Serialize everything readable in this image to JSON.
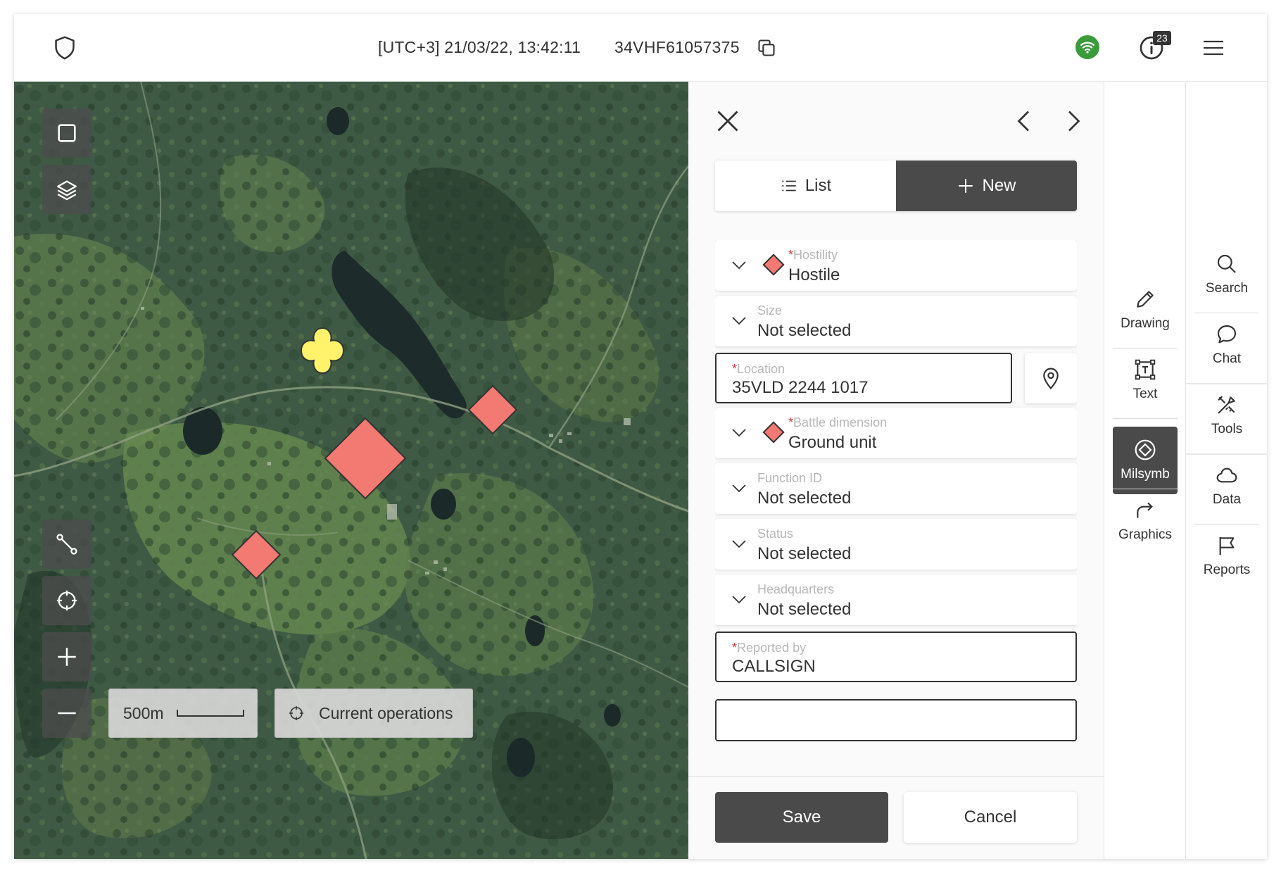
{
  "topbar": {
    "datetime": "[UTC+3] 21/03/22, 13:42:11",
    "mgrs": "34VHF61057375",
    "notification_count": "23",
    "status_color": "#3a9b3a"
  },
  "map": {
    "scale_label": "500m",
    "operations_label": "Current operations",
    "hostile_color": "#f27a72",
    "unknown_color": "#fff36b"
  },
  "panel": {
    "segments": {
      "list": "List",
      "new": "New"
    },
    "fields": {
      "hostility": {
        "label": "Hostility",
        "required": "*",
        "value": "Hostile"
      },
      "size": {
        "label": "Size",
        "value": "Not selected"
      },
      "location": {
        "label": "Location",
        "required": "*",
        "value": "35VLD 2244 1017"
      },
      "battle_dimension": {
        "label": "Battle dimension",
        "required": "*",
        "value": "Ground unit"
      },
      "function_id": {
        "label": "Function ID",
        "value": "Not selected"
      },
      "status": {
        "label": "Status",
        "value": "Not selected"
      },
      "headquarters": {
        "label": "Headquarters",
        "value": "Not selected"
      },
      "reported_by": {
        "label": "Reported by",
        "required": "*",
        "value": "CALLSIGN"
      }
    },
    "save_label": "Save",
    "cancel_label": "Cancel"
  },
  "rail": {
    "drawing": "Drawing",
    "text": "Text",
    "milsymb": "Milsymb",
    "graphics": "Graphics",
    "search": "Search",
    "chat": "Chat",
    "tools": "Tools",
    "data": "Data",
    "reports": "Reports"
  }
}
